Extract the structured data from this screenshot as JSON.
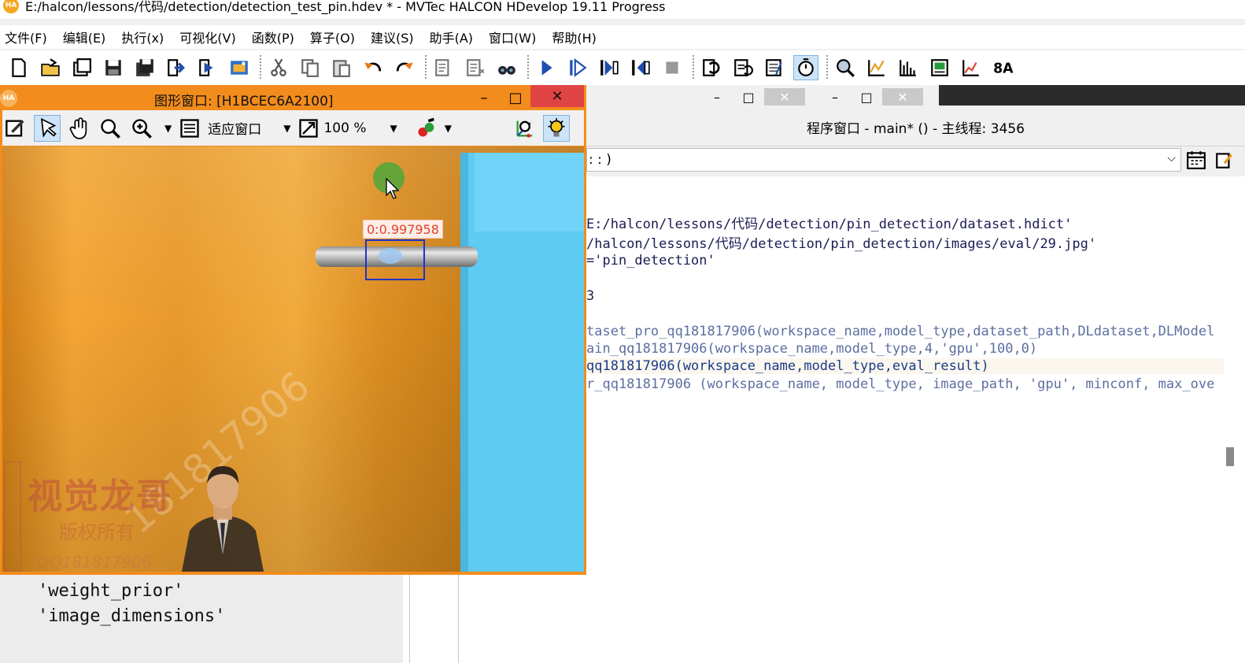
{
  "window": {
    "title": "E:/halcon/lessons/代码/detection/detection_test_pin.hdev * - MVTec HALCON HDevelop 19.11 Progress",
    "app_icon_text": "HA"
  },
  "menu": [
    {
      "label": "文件(F)"
    },
    {
      "label": "编辑(E)"
    },
    {
      "label": "执行(x)"
    },
    {
      "label": "可视化(V)"
    },
    {
      "label": "函数(P)"
    },
    {
      "label": "算子(O)"
    },
    {
      "label": "建议(S)"
    },
    {
      "label": "助手(A)"
    },
    {
      "label": "窗口(W)"
    },
    {
      "label": "帮助(H)"
    }
  ],
  "toolbar_icons": [
    "new-file-icon",
    "open-file-icon",
    "open-window-icon",
    "save-icon",
    "save-all-icon",
    "import-icon",
    "export-icon",
    "image-acquisition-icon",
    "cut-icon",
    "copy-icon",
    "paste-icon",
    "undo-icon",
    "redo-icon",
    "activate-line-icon",
    "deactivate-line-icon",
    "find-icon",
    "run-icon",
    "step-over-icon",
    "step-into-icon",
    "step-out-icon",
    "stop-icon",
    "reset-program-icon",
    "reset-procedure-icon",
    "profiler-icon",
    "timer-icon",
    "gray-histogram-icon",
    "line-profile-icon",
    "feature-histogram-icon",
    "feature-inspection-icon",
    "ocr-icon"
  ],
  "graphics_window": {
    "title": "图形窗口: [H1BCEC6A2100]",
    "icon_text": "HA",
    "minimize": "–",
    "maximize": "□",
    "close": "✕",
    "toolbar": {
      "fit_label": "适应窗口",
      "zoom_value": "100 %"
    },
    "detection": {
      "label": "0:0.997958"
    },
    "watermark": {
      "title": "视觉龙哥",
      "rights": "版权所有",
      "qq": "QQ181817906",
      "diagonal": "181817906"
    }
  },
  "program_window": {
    "header": "程序窗口 - main* () - 主线程: 3456",
    "combo_value": ": : )",
    "tab_controls": [
      "–",
      "□",
      "✕",
      "–",
      "□",
      "✕"
    ],
    "code_lines": [
      {
        "text": "E:/halcon/lessons/代码/detection/pin_detection/dataset.hdict'",
        "style": "dark"
      },
      {
        "text": "/halcon/lessons/代码/detection/pin_detection/images/eval/29.jpg'",
        "style": "dark"
      },
      {
        "text": "='pin_detection'",
        "style": "dark"
      },
      {
        "text": "3",
        "style": "dark"
      },
      {
        "text": "taset_pro_qq181817906(workspace_name,model_type,dataset_path,DLdataset,DLModel",
        "style": "light"
      },
      {
        "text": "ain_qq181817906(workspace_name,model_type,4,'gpu',100,0)",
        "style": "light"
      },
      {
        "text": "qq181817906(workspace_name,model_type,eval_result)",
        "style": "highlight"
      },
      {
        "text": "r_qq181817906 (workspace_name, model_type, image_path, 'gpu', minconf, max_ove",
        "style": "light"
      }
    ]
  },
  "variable_window": {
    "lines": [
      "'weight_prior'",
      "'image_dimensions'"
    ]
  }
}
